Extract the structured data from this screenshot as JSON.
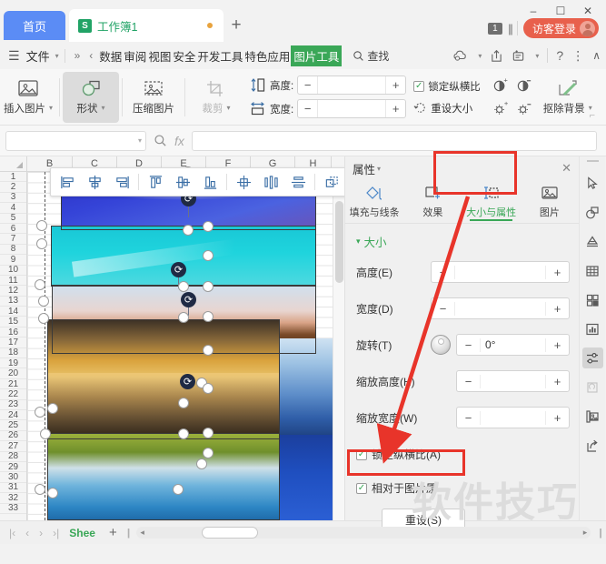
{
  "titlebar": {
    "home_tab": "首页",
    "doc_tab": "工作簿1",
    "doc_icon": "s-badge-icon",
    "modified_dot": "unsaved-dot-icon",
    "add_tab": "+",
    "count_badge": "1",
    "login_label": "访客登录",
    "window_minimize": "–",
    "window_maximize": "☐",
    "window_close": "✕"
  },
  "menubar": {
    "hamburger": "☰",
    "file": "文件",
    "overflow": "»",
    "scroll_left": "‹",
    "tabs": [
      {
        "label": "数据",
        "active": false
      },
      {
        "label": "审阅",
        "active": false
      },
      {
        "label": "视图",
        "active": false
      },
      {
        "label": "安全",
        "active": false
      },
      {
        "label": "开发工具",
        "active": false
      },
      {
        "label": "特色应用",
        "active": false
      },
      {
        "label": "图片工具",
        "active": true
      }
    ],
    "find": "查找",
    "right_icons": [
      "cloud-sync-icon",
      "share-icon",
      "collaborate-icon",
      "help-icon",
      "more-icon",
      "collapse-ribbon-icon"
    ]
  },
  "ribbon": {
    "insert_picture": "插入图片",
    "shapes": "形状",
    "compress_picture": "压缩图片",
    "crop": "裁剪",
    "height_label": "高度:",
    "height_value": "",
    "width_label": "宽度:",
    "width_value": "",
    "lock_aspect": "锁定纵横比",
    "lock_aspect_checked": true,
    "reset_size": "重设大小",
    "remove_background": "抠除背景",
    "adjust_icons": [
      "contrast-increase-icon",
      "contrast-decrease-icon",
      "brightness-increase-icon",
      "brightness-decrease-icon"
    ],
    "minus": "−",
    "plus": "+"
  },
  "formulabar": {
    "namebox_value": "",
    "fx": "fx",
    "formula_value": "",
    "zoom_icon": "zoom-find-icon"
  },
  "sheet": {
    "columns": [
      "B",
      "C",
      "D",
      "E",
      "F",
      "G",
      "H"
    ],
    "rows": [
      "1",
      "2",
      "3",
      "4",
      "5",
      "6",
      "7",
      "8",
      "9",
      "10",
      "11",
      "12",
      "13",
      "14",
      "15",
      "16",
      "17",
      "18",
      "19",
      "20",
      "21",
      "22",
      "23",
      "24",
      "25",
      "26",
      "27",
      "28",
      "29",
      "30",
      "31",
      "32",
      "33"
    ],
    "align_toolbar": [
      "align-left-icon",
      "align-center-horizontal-icon",
      "align-right-icon",
      "align-top-icon",
      "align-middle-icon",
      "align-bottom-icon",
      "align-to-grid-icon",
      "distribute-horizontal-icon",
      "distribute-vertical-icon",
      "group-objects-icon"
    ],
    "pictures": [
      {
        "name": "picture-blue-sky"
      },
      {
        "name": "picture-cyan-sky"
      },
      {
        "name": "picture-sunset-skyline"
      },
      {
        "name": "picture-venice-canal"
      },
      {
        "name": "picture-blue-mountains"
      },
      {
        "name": "picture-green-lake"
      },
      {
        "name": "picture-deep-blue"
      }
    ]
  },
  "panel": {
    "title": "属性",
    "close": "✕",
    "tabs": [
      {
        "label": "填充与线条",
        "icon": "fill-line-icon",
        "active": false
      },
      {
        "label": "效果",
        "icon": "effects-icon",
        "active": false
      },
      {
        "label": "大小与属性",
        "icon": "size-properties-icon",
        "active": true
      },
      {
        "label": "图片",
        "icon": "picture-icon",
        "active": false
      }
    ],
    "section_title": "大小",
    "fields": [
      {
        "label": "高度(E)",
        "value": "",
        "name": "height-field"
      },
      {
        "label": "宽度(D)",
        "value": "",
        "name": "width-field"
      },
      {
        "label": "旋转(T)",
        "value": "0°",
        "name": "rotation-field"
      },
      {
        "label": "缩放高度(H)",
        "value": "",
        "name": "scale-height-field"
      },
      {
        "label": "缩放宽度(W)",
        "value": "",
        "name": "scale-width-field"
      }
    ],
    "checkbox_lock": "锁定纵横比(A)",
    "checkbox_relative": "相对于图片原",
    "reset_button": "重设(S)",
    "minus": "−",
    "plus": "+"
  },
  "rail": {
    "icons": [
      "select-cursor-icon",
      "shapes-icon",
      "text-effects-icon",
      "table-icon",
      "components-icon",
      "chart-icon",
      "properties-icon",
      "refresh-icon",
      "image-gallery-icon",
      "export-icon"
    ]
  },
  "statusbar": {
    "first_sheet": "|‹",
    "prev_sheet": "‹",
    "next_sheet": "›",
    "last_sheet": "›|",
    "sheet_name": "Shee",
    "add_sheet": "+",
    "scroll_left": "◂",
    "scroll_right": "▸"
  },
  "watermark": "软件技巧",
  "colors": {
    "accent_green": "#3aa757",
    "home_tab_blue": "#5b8cf5",
    "login_red": "#e8604c",
    "highlight_red": "#e8342a"
  }
}
